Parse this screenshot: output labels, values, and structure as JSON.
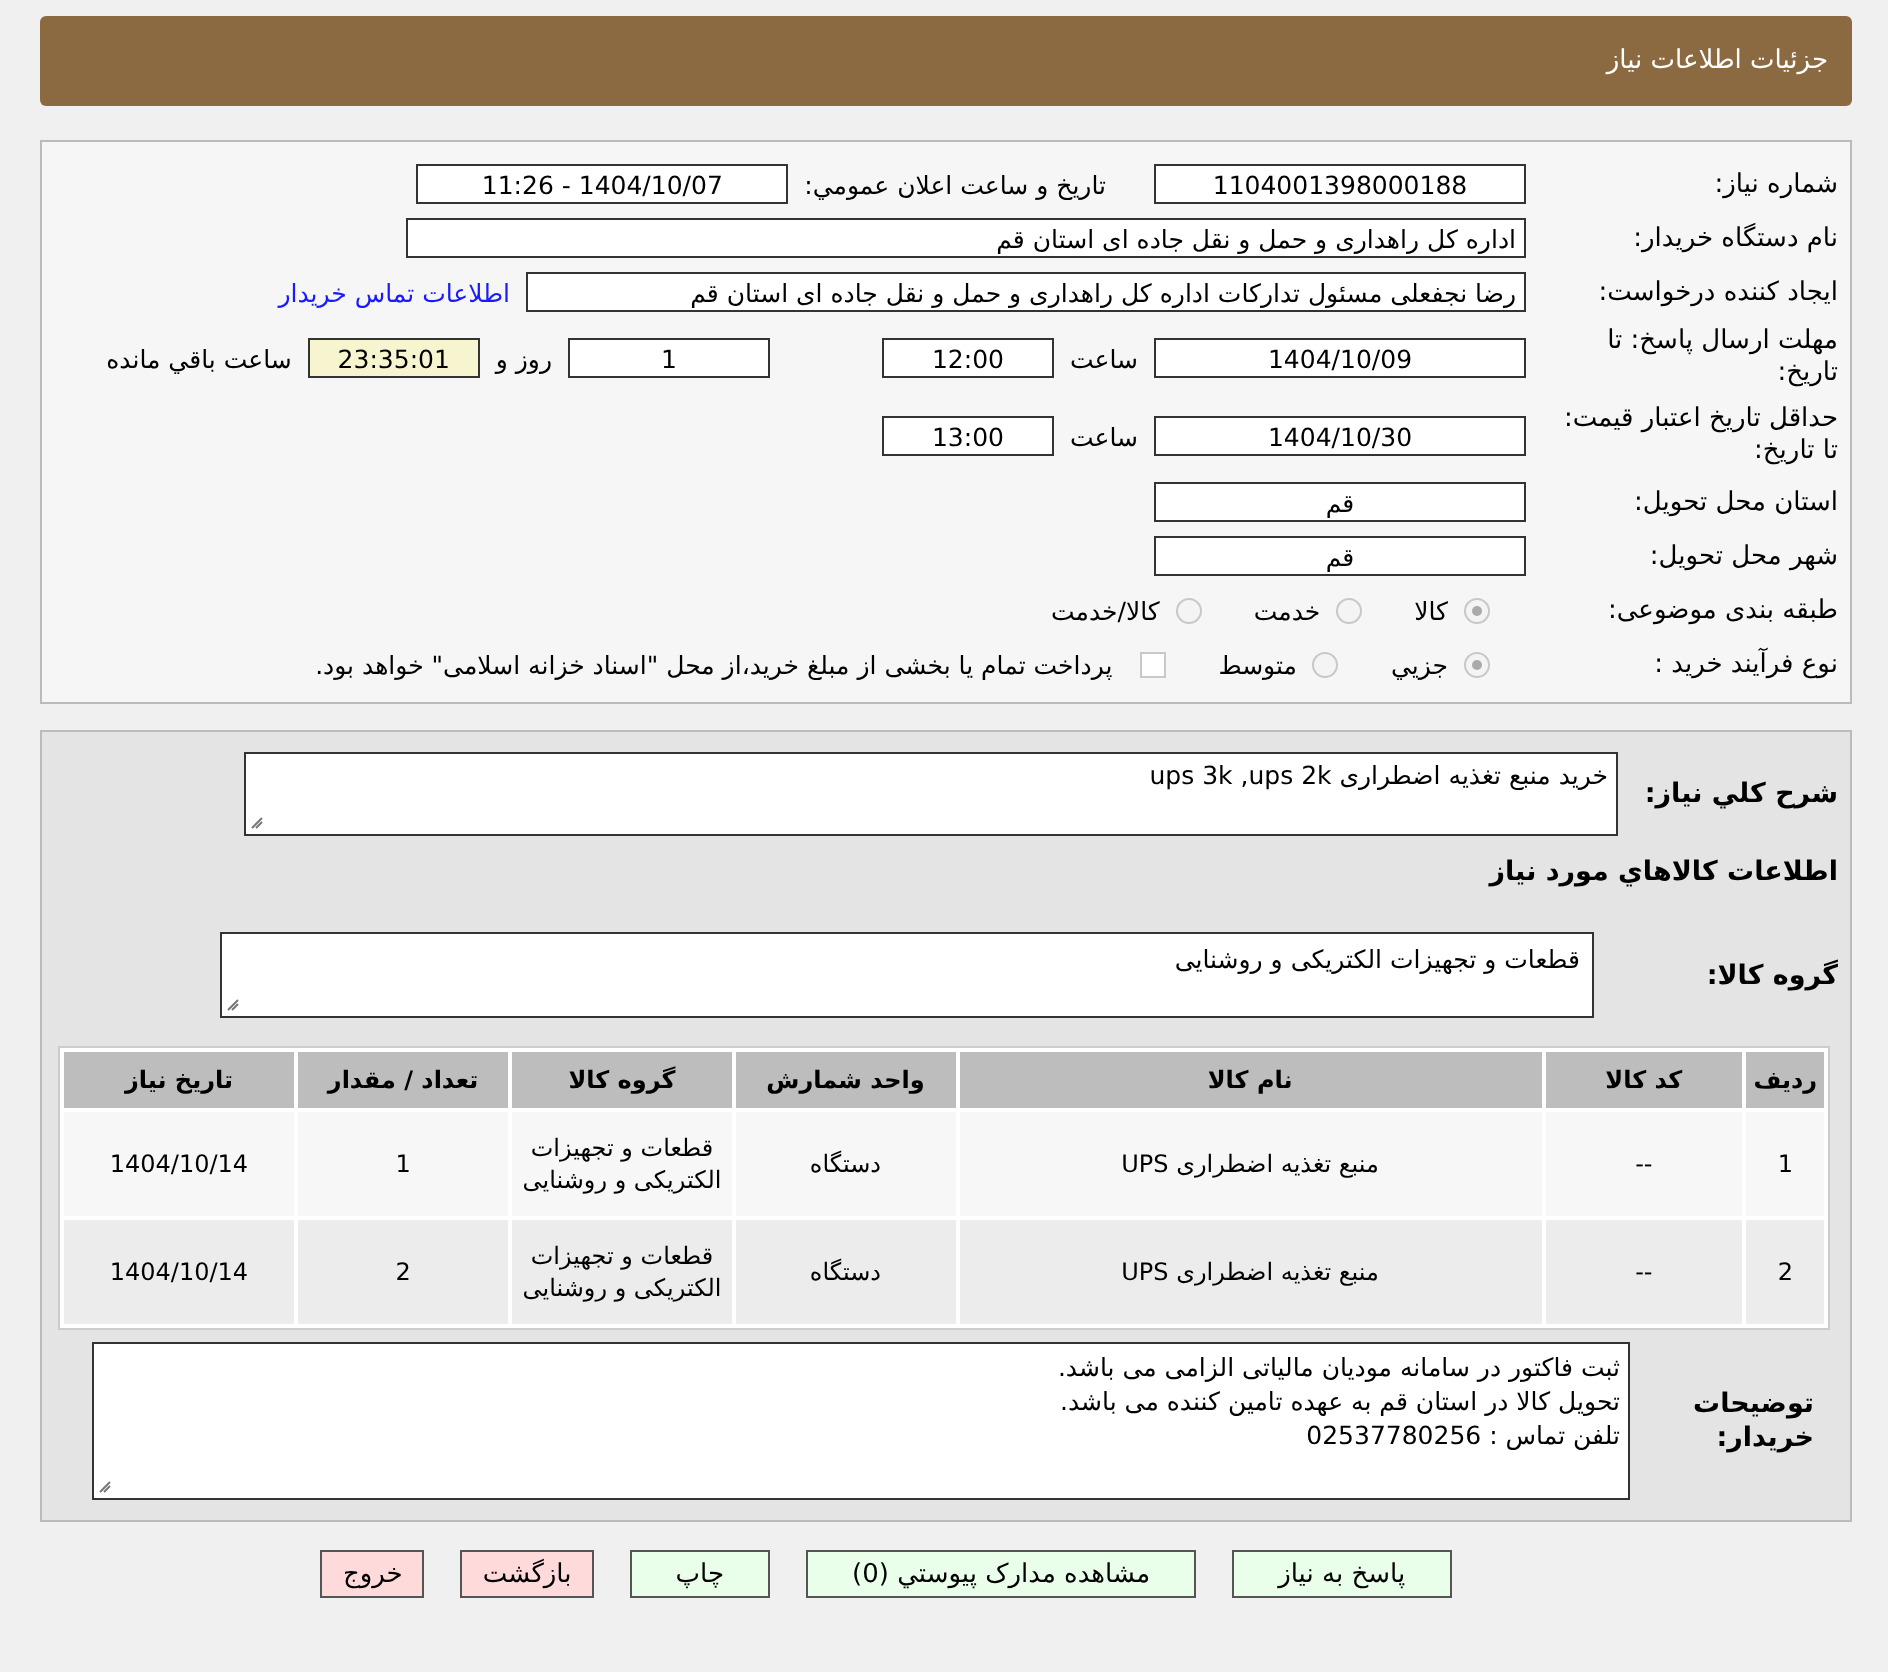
{
  "header": {
    "title": "جزئيات اطلاعات نياز"
  },
  "details": {
    "need_number": {
      "label": "شماره نياز:",
      "value": "1104001398000188"
    },
    "announce": {
      "label": "تاريخ و ساعت اعلان عمومي:",
      "value": "1404/10/07 - 11:26"
    },
    "buyer_org": {
      "label": "نام دستگاه خريدار:",
      "value": "اداره کل راهداری و حمل و نقل جاده ای استان قم"
    },
    "requester": {
      "label": "ايجاد کننده درخواست:",
      "value": "رضا  نجفعلی مسئول تدارکات اداره کل راهداری و حمل و نقل جاده ای استان قم",
      "link": "اطلاعات تماس خريدار"
    },
    "deadline": {
      "label": "مهلت ارسال پاسخ: تا تاریخ:",
      "date": "1404/10/09",
      "time_label": "ساعت",
      "time": "12:00",
      "days": "1",
      "days_label": "روز و",
      "remaining": "23:35:01",
      "remaining_label": "ساعت باقي مانده"
    },
    "validity": {
      "label": "حداقل تاريخ اعتبار قيمت: تا تاريخ:",
      "date": "1404/10/30",
      "time_label": "ساعت",
      "time": "13:00"
    },
    "province": {
      "label": "استان محل تحويل:",
      "value": "قم"
    },
    "city": {
      "label": "شهر محل تحويل:",
      "value": "قم"
    },
    "category": {
      "label": "طبقه بندی موضوعی:",
      "options": [
        {
          "label": "كالا",
          "selected": true
        },
        {
          "label": "خدمت",
          "selected": false
        },
        {
          "label": "كالا/خدمت",
          "selected": false
        }
      ]
    },
    "process": {
      "label": "نوع فرآيند خريد :",
      "options": [
        {
          "label": "جزيي",
          "selected": true
        },
        {
          "label": "متوسط",
          "selected": false
        }
      ],
      "payment": {
        "checked": false,
        "text": "پرداخت تمام يا بخشی از مبلغ خريد،از محل \"اسناد خزانه اسلامی\" خواهد بود."
      }
    }
  },
  "items": {
    "description": {
      "label": "شرح كلي نياز:",
      "value": "خريد منبع تغذيه اضطراری  ups 3k ,ups 2k"
    },
    "heading": "اطلاعات كالاهاي مورد نياز",
    "goods_group": {
      "label": "گروه كالا:",
      "value": "قطعات و تجهيزات الکتريکی و روشنايی"
    },
    "table": {
      "columns": [
        "رديف",
        "کد کالا",
        "نام کالا",
        "واحد شمارش",
        "گروه کالا",
        "تعداد / مقدار",
        "تاريخ نياز"
      ],
      "rows": [
        [
          "1",
          "--",
          "منبع تغذيه اضطراری UPS",
          "دستگاه",
          "قطعات و تجهيزات الکتريکی و روشنايی",
          "1",
          "1404/10/14"
        ],
        [
          "2",
          "--",
          "منبع تغذيه اضطراری UPS",
          "دستگاه",
          "قطعات و تجهيزات الکتريکی و روشنايی",
          "2",
          "1404/10/14"
        ]
      ]
    },
    "buyer_notes": {
      "label": "توضيحات خريدار:",
      "lines": [
        "ثبت فاکتور در سامانه موديان مالياتی الزامی می باشد.",
        "تحويل کالا در استان قم به عهده تامين کننده می باشد.",
        "تلفن تماس : 02537780256"
      ]
    }
  },
  "buttons": [
    {
      "label": "پاسخ به نياز",
      "kind": "go"
    },
    {
      "label": "مشاهده مدارک پيوستي (0)",
      "kind": "go"
    },
    {
      "label": "چاپ",
      "kind": "go"
    },
    {
      "label": "بازگشت",
      "kind": "back"
    },
    {
      "label": "خروج",
      "kind": "back"
    }
  ]
}
